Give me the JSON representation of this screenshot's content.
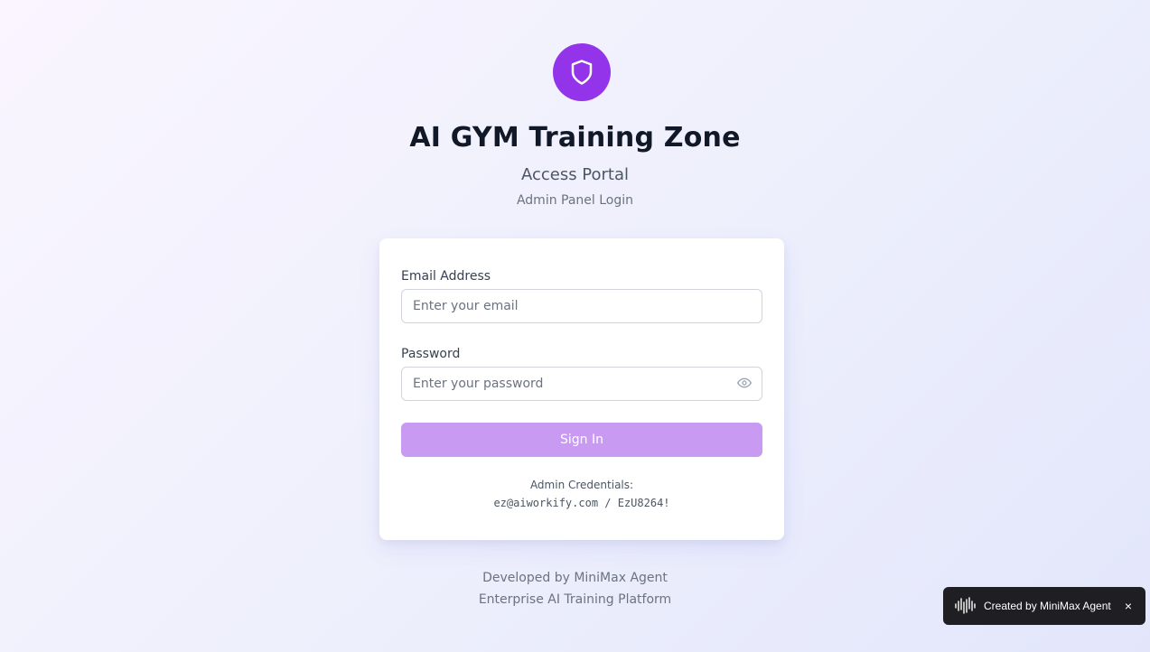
{
  "app": {
    "logo_icon": "shield-icon",
    "title": "AI GYM Training Zone",
    "subtitle": "Access Portal",
    "description": "Admin Panel Login"
  },
  "form": {
    "email_label": "Email Address",
    "email_placeholder": "Enter your email",
    "email_value": "",
    "password_label": "Password",
    "password_placeholder": "Enter your password",
    "password_value": "",
    "password_toggle_icon": "eye-icon",
    "submit_label": "Sign In"
  },
  "credentials": {
    "title": "Admin Credentials:",
    "value": "ez@aiworkify.com / EzU8264!"
  },
  "footer": {
    "line1": "Developed by MiniMax Agent",
    "line2": "Enterprise AI Training Platform"
  },
  "badge": {
    "icon": "waveform-icon",
    "text": "Created by MiniMax Agent",
    "close": "×"
  },
  "colors": {
    "accent": "#9333ea",
    "button": "#c89af1",
    "badge_bg": "#1f1f23"
  }
}
